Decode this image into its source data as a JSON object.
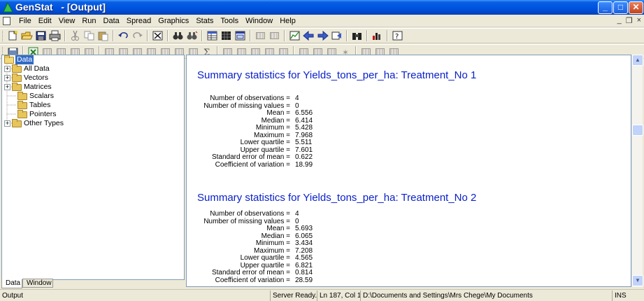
{
  "window": {
    "title": "GenStat   - [Output]",
    "controls": {
      "minimize": "_",
      "maximize": "□",
      "close": "✕"
    }
  },
  "menubar": {
    "items": [
      "File",
      "Edit",
      "View",
      "Run",
      "Data",
      "Spread",
      "Graphics",
      "Stats",
      "Tools",
      "Window",
      "Help"
    ],
    "mdi_controls": [
      "_",
      "❐",
      "×"
    ]
  },
  "tree": {
    "root": "Data",
    "items": [
      {
        "label": "All Data",
        "expandable": true
      },
      {
        "label": "Vectors",
        "expandable": true
      },
      {
        "label": "Matrices",
        "expandable": true
      },
      {
        "label": "Scalars",
        "expandable": false
      },
      {
        "label": "Tables",
        "expandable": false
      },
      {
        "label": "Pointers",
        "expandable": false
      },
      {
        "label": "Other Types",
        "expandable": true
      }
    ],
    "tabs": [
      "Data",
      "Window"
    ]
  },
  "output": {
    "sections": [
      {
        "heading": "Summary statistics for Yields_tons_per_ha: Treatment_No 1",
        "stats": [
          {
            "label": "Number of observations =",
            "value": "4"
          },
          {
            "label": "Number of missing values =",
            "value": "0"
          },
          {
            "label": "Mean =",
            "value": "6.556"
          },
          {
            "label": "Median =",
            "value": "6.414"
          },
          {
            "label": "Minimum =",
            "value": "5.428"
          },
          {
            "label": "Maximum =",
            "value": "7.968"
          },
          {
            "label": "Lower quartile =",
            "value": "5.511"
          },
          {
            "label": "Upper quartile =",
            "value": "7.601"
          },
          {
            "label": "Standard error of mean =",
            "value": "0.622"
          },
          {
            "label": "Coefficient of variation =",
            "value": "18.99"
          }
        ]
      },
      {
        "heading": "Summary statistics for Yields_tons_per_ha: Treatment_No 2",
        "stats": [
          {
            "label": "Number of observations =",
            "value": "4"
          },
          {
            "label": "Number of missing values =",
            "value": "0"
          },
          {
            "label": "Mean =",
            "value": "5.693"
          },
          {
            "label": "Median =",
            "value": "6.065"
          },
          {
            "label": "Minimum =",
            "value": "3.434"
          },
          {
            "label": "Maximum =",
            "value": "7.208"
          },
          {
            "label": "Lower quartile =",
            "value": "4.565"
          },
          {
            "label": "Upper quartile =",
            "value": "6.821"
          },
          {
            "label": "Standard error of mean =",
            "value": "0.814"
          },
          {
            "label": "Coefficient of variation =",
            "value": "28.59"
          }
        ]
      }
    ]
  },
  "statusbar": {
    "left": "Output",
    "state": "Server Ready.",
    "position": "Ln 187, Col 1",
    "path": "D:\\Documents and Settings\\Mrs Chege\\My Documents",
    "mode": "INS"
  }
}
